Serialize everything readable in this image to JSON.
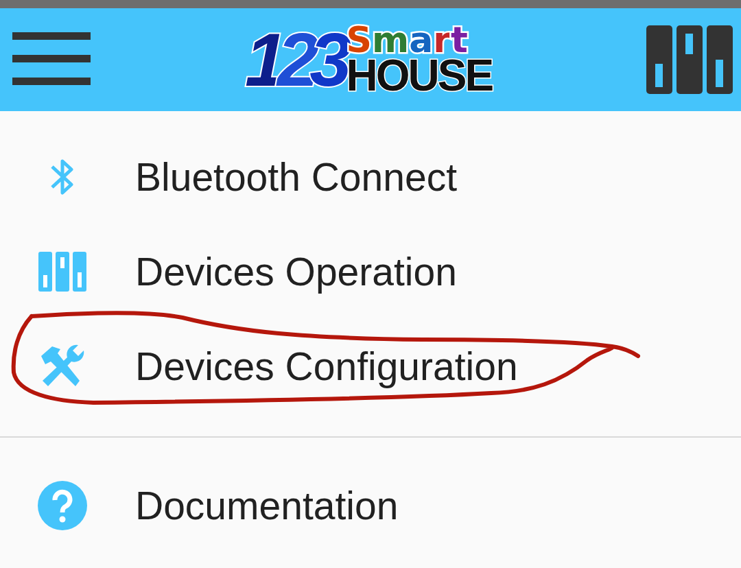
{
  "header": {
    "logo": {
      "digits": "123",
      "word_top": "Smart",
      "word_bottom": "HOUSE"
    }
  },
  "menu": {
    "sections": [
      {
        "items": [
          {
            "kind": "bluetooth",
            "label": "Bluetooth Connect",
            "circled": false
          },
          {
            "kind": "devices",
            "label": "Devices Operation",
            "circled": false
          },
          {
            "kind": "tools",
            "label": "Devices Configuration",
            "circled": true
          }
        ]
      },
      {
        "items": [
          {
            "kind": "help",
            "label": "Documentation",
            "circled": false
          }
        ]
      }
    ]
  }
}
